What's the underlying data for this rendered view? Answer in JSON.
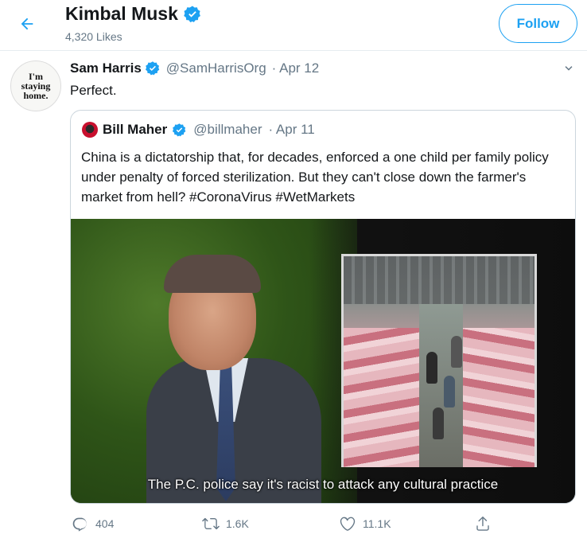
{
  "header": {
    "title": "Kimbal Musk",
    "likes": "4,320 Likes",
    "follow_label": "Follow"
  },
  "tweet": {
    "author_name": "Sam Harris",
    "author_handle": "@SamHarrisOrg",
    "date": "· Apr 12",
    "avatar_text": [
      "I'm",
      "staying",
      "home."
    ],
    "text": "Perfect.",
    "actions": {
      "replies": "404",
      "retweets": "1.6K",
      "likes": "11.1K"
    }
  },
  "quote": {
    "author_name": "Bill Maher",
    "author_handle": "@billmaher",
    "date": "· Apr 11",
    "text": "China is a dictatorship that, for decades, enforced a one child per family policy under penalty of forced sterilization. But they can't close down the farmer's market from hell?  #CoronaVirus #WetMarkets",
    "media_subtitle": "The P.C. police say it's racist to attack any cultural practice"
  },
  "colors": {
    "accent": "#1da1f2",
    "muted": "#657786",
    "text": "#14171a",
    "border": "#ccd6dd"
  },
  "icons": [
    "back-arrow-icon",
    "verified-badge-icon",
    "chevron-down-icon",
    "reply-icon",
    "retweet-icon",
    "like-icon",
    "share-icon"
  ]
}
